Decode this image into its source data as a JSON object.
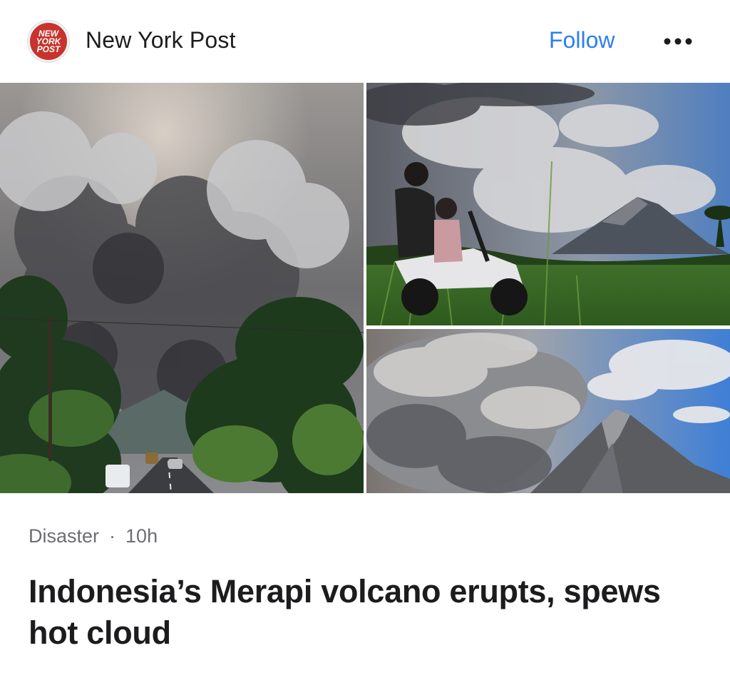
{
  "header": {
    "logo_text": "NEW YORK POST",
    "source_name": "New York Post",
    "follow_label": "Follow",
    "more_icon": "ellipsis-icon",
    "accent_color": "#2d7ff0",
    "brand_color": "#c8332d"
  },
  "meta": {
    "category": "Disaster",
    "separator": "·",
    "time_ago": "10h"
  },
  "article": {
    "headline": "Indonesia’s Merapi volcano erupts, spews hot cloud"
  }
}
